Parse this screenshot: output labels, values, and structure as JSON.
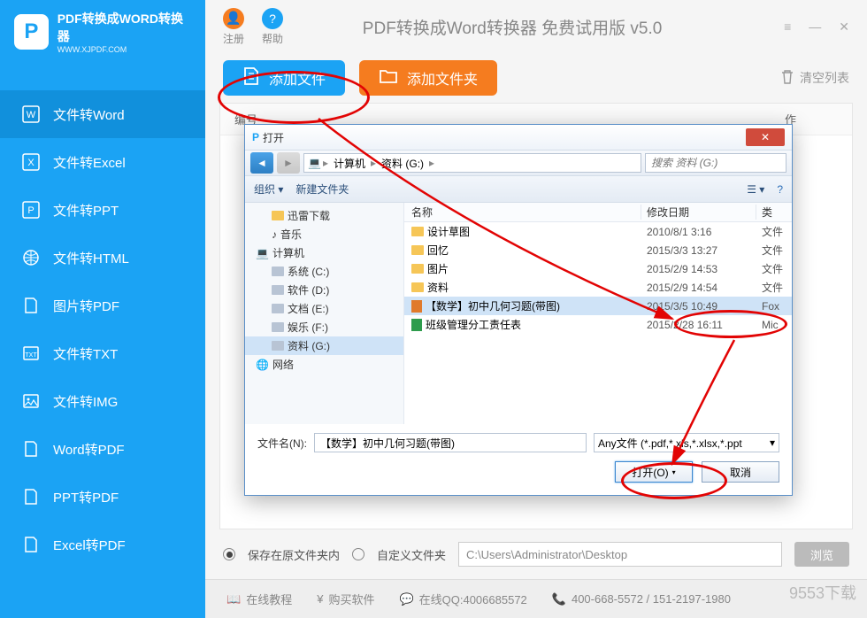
{
  "app": {
    "title": "PDF转换成WORD转换器",
    "subtitle": "WWW.XJPDF.COM",
    "window_title": "PDF转换成Word转换器 免费试用版 v5.0"
  },
  "topbar": {
    "register": "注册",
    "help": "帮助"
  },
  "sidebar": {
    "items": [
      {
        "label": "文件转Word"
      },
      {
        "label": "文件转Excel"
      },
      {
        "label": "文件转PPT"
      },
      {
        "label": "文件转HTML"
      },
      {
        "label": "图片转PDF"
      },
      {
        "label": "文件转TXT"
      },
      {
        "label": "文件转IMG"
      },
      {
        "label": "Word转PDF"
      },
      {
        "label": "PPT转PDF"
      },
      {
        "label": "Excel转PDF"
      }
    ]
  },
  "toolbar": {
    "add_file": "添加文件",
    "add_folder": "添加文件夹",
    "clear_list": "清空列表"
  },
  "content": {
    "col_index": "编号",
    "col_op": "作"
  },
  "bottom": {
    "opt_original": "保存在原文件夹内",
    "opt_custom": "自定义文件夹",
    "path_value": "C:\\Users\\Administrator\\Desktop",
    "browse": "浏览"
  },
  "footer": {
    "tutorial": "在线教程",
    "buy": "购买软件",
    "qq": "在线QQ:4006685572",
    "phone": "400-668-5572 / 151-2197-1980"
  },
  "dialog": {
    "title": "打开",
    "breadcrumb": {
      "root": "计算机",
      "drive": "资料 (G:)"
    },
    "search_placeholder": "搜索 资料 (G:)",
    "organize": "组织",
    "new_folder": "新建文件夹",
    "tree": [
      {
        "label": "迅雷下载",
        "lvl": 1,
        "icon": "folder"
      },
      {
        "label": "音乐",
        "lvl": 1,
        "icon": "music"
      },
      {
        "label": "计算机",
        "lvl": 0,
        "icon": "computer"
      },
      {
        "label": "系统 (C:)",
        "lvl": 1,
        "icon": "drive"
      },
      {
        "label": "软件 (D:)",
        "lvl": 1,
        "icon": "drive"
      },
      {
        "label": "文档 (E:)",
        "lvl": 1,
        "icon": "drive"
      },
      {
        "label": "娱乐 (F:)",
        "lvl": 1,
        "icon": "drive"
      },
      {
        "label": "资料 (G:)",
        "lvl": 1,
        "icon": "drive",
        "sel": true
      },
      {
        "label": "网络",
        "lvl": 0,
        "icon": "network"
      }
    ],
    "list_head": {
      "name": "名称",
      "date": "修改日期",
      "type": "类"
    },
    "list": [
      {
        "name": "设计草图",
        "date": "2010/8/1 3:16",
        "type": "文件",
        "icon": "folder"
      },
      {
        "name": "回忆",
        "date": "2015/3/3 13:27",
        "type": "文件",
        "icon": "folder"
      },
      {
        "name": "图片",
        "date": "2015/2/9 14:53",
        "type": "文件",
        "icon": "folder"
      },
      {
        "name": "资料",
        "date": "2015/2/9 14:54",
        "type": "文件",
        "icon": "folder"
      },
      {
        "name": "【数学】初中几何习题(带图)",
        "date": "2015/3/5 10:49",
        "type": "Fox",
        "icon": "fox",
        "sel": true
      },
      {
        "name": "班级管理分工责任表",
        "date": "2015/2/28 16:11",
        "type": "Mic",
        "icon": "xls"
      }
    ],
    "filename_label": "文件名(N):",
    "filename_value": "【数学】初中几何习题(带图)",
    "filter": "Any文件 (*.pdf,*.xls,*.xlsx,*.ppt",
    "open": "打开(O)",
    "cancel": "取消"
  },
  "watermark": "9553下载"
}
